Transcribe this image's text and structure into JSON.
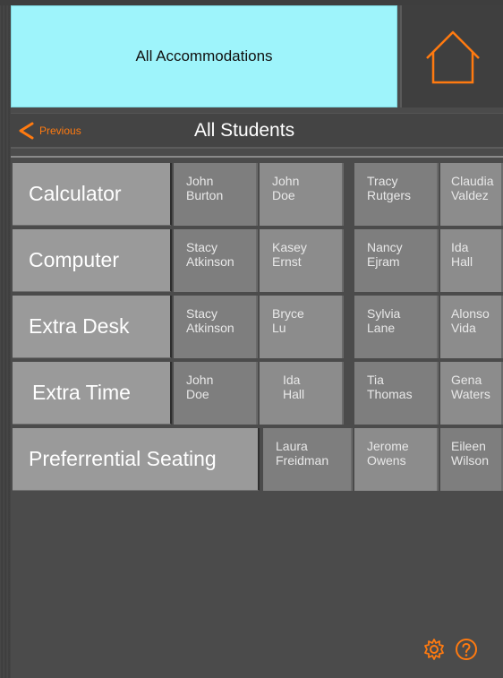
{
  "header": {
    "title": "All Accommodations",
    "home_icon": "home-icon"
  },
  "nav": {
    "previous_label": "Previous",
    "title": "All Students"
  },
  "colors": {
    "accent": "#ff7a10",
    "banner": "#9ef4fb"
  },
  "accommodations": [
    {
      "name": "Calculator",
      "students": [
        "John\nBurton",
        "John\nDoe",
        "Tracy\nRutgers",
        "Claudia\nValdez"
      ]
    },
    {
      "name": "Computer",
      "students": [
        "Stacy\nAtkinson",
        "Kasey\nErnst",
        "Nancy\nEjram",
        "Ida\nHall"
      ]
    },
    {
      "name": "Extra Desk",
      "students": [
        "Stacy\nAtkinson",
        "Bryce\nLu",
        "Sylvia\nLane",
        "Alonso\nVida"
      ]
    },
    {
      "name": "Extra Time",
      "students": [
        "John\nDoe",
        "Ida\nHall",
        "Tia\nThomas",
        "Gena\nWaters"
      ]
    },
    {
      "name": "Preferrential Seating",
      "students": [
        "Laura\nFreidman",
        "Jerome\nOwens",
        "Eileen\nWilson"
      ]
    }
  ]
}
